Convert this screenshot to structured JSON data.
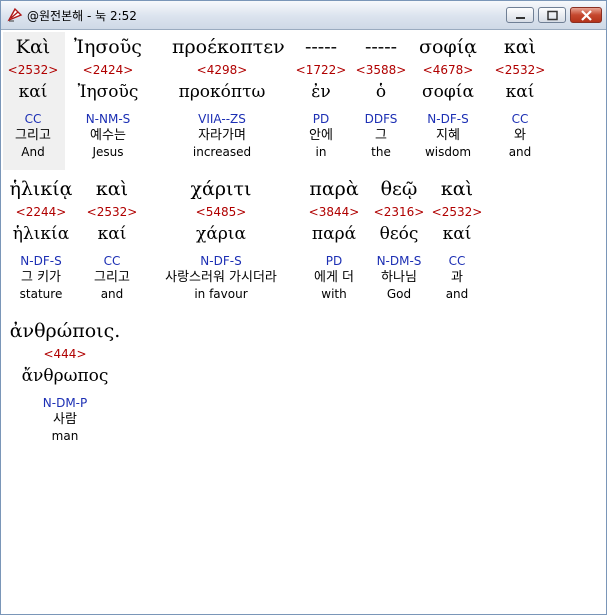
{
  "window": {
    "title": "@원전본해 - 눅 2:52",
    "controls": [
      "minimize-icon",
      "maximize-icon",
      "close-icon"
    ]
  },
  "colors": {
    "strongs": "#b00000",
    "morph": "#1c2fb4",
    "text": "#000000"
  },
  "rows": [
    {
      "words": [
        {
          "greek": "Καὶ",
          "strongs": "<2532>",
          "lexeme": "καί",
          "morph": "CC",
          "korean": "그리고",
          "english": "And"
        },
        {
          "greek": "Ἰησοῦς",
          "strongs": "<2424>",
          "lexeme": "Ἰησοῦς",
          "morph": "N-NM-S",
          "korean": "예수는",
          "english": "Jesus"
        },
        {
          "greek": "προέκοπτεν",
          "strongs": "<4298>",
          "lexeme": "προκόπτω",
          "morph": "VIIA--ZS",
          "korean": "자라가며",
          "english": "increased"
        },
        {
          "greek": "-----",
          "strongs": "<1722>",
          "lexeme": "ἐν",
          "morph": "PD",
          "korean": "안에",
          "english": "in"
        },
        {
          "greek": "-----",
          "strongs": "<3588>",
          "lexeme": "ὁ",
          "morph": "DDFS",
          "korean": "그",
          "english": "the"
        },
        {
          "greek": "σοφίᾳ",
          "strongs": "<4678>",
          "lexeme": "σοφία",
          "morph": "N-DF-S",
          "korean": "지혜",
          "english": "wisdom"
        },
        {
          "greek": "καὶ",
          "strongs": "<2532>",
          "lexeme": "καί",
          "morph": "CC",
          "korean": "와",
          "english": "and"
        }
      ]
    },
    {
      "words": [
        {
          "greek": "ἡλικίᾳ",
          "strongs": "<2244>",
          "lexeme": "ἡλικία",
          "morph": "N-DF-S",
          "korean": "그 키가",
          "english": "stature"
        },
        {
          "greek": "καὶ",
          "strongs": "<2532>",
          "lexeme": "καί",
          "morph": "CC",
          "korean": "그리고",
          "english": "and"
        },
        {
          "greek": "χάριτι",
          "strongs": "<5485>",
          "lexeme": "χάρια",
          "morph": "N-DF-S",
          "korean": "사랑스러워 가시더라",
          "english": "in favour"
        },
        {
          "greek": "παρὰ",
          "strongs": "<3844>",
          "lexeme": "παρά",
          "morph": "PD",
          "korean": "에게 더",
          "english": "with"
        },
        {
          "greek": "θεῷ",
          "strongs": "<2316>",
          "lexeme": "θεός",
          "morph": "N-DM-S",
          "korean": "하나님",
          "english": "God"
        },
        {
          "greek": "καὶ",
          "strongs": "<2532>",
          "lexeme": "καί",
          "morph": "CC",
          "korean": "과",
          "english": "and"
        }
      ]
    },
    {
      "words": [
        {
          "greek": "ἀνθρώποις.",
          "strongs": "<444>",
          "lexeme": "ἄνθρωπος",
          "morph": "N-DM-P",
          "korean": "사람",
          "english": "man"
        }
      ]
    }
  ]
}
